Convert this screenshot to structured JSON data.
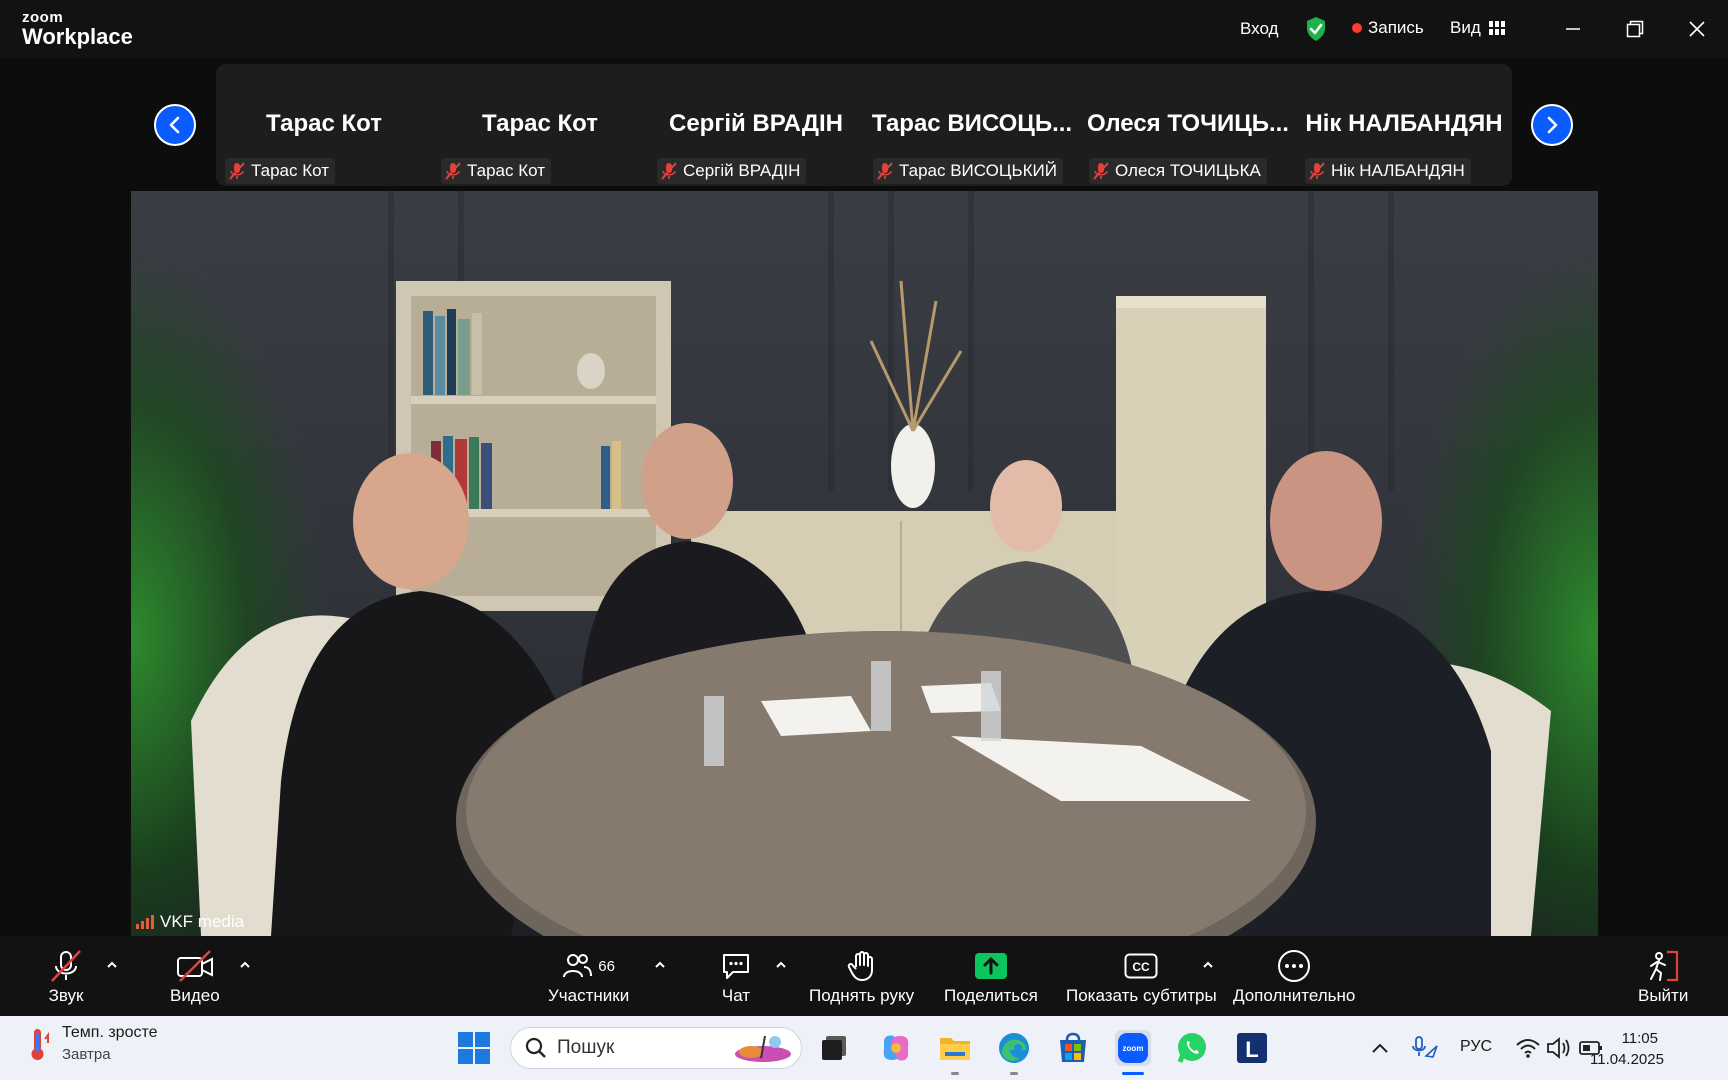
{
  "app": {
    "logo_top": "zoom",
    "logo_bottom": "Workplace"
  },
  "titlebar": {
    "login": "Вход",
    "record": "Запись",
    "view": "Вид"
  },
  "participants_strip": [
    {
      "display": "Тарас Кот",
      "name": "Тарас Кот"
    },
    {
      "display": "Тарас Кот",
      "name": "Тарас Кот"
    },
    {
      "display": "Сергій ВРАДІН",
      "name": "Сергій ВРАДІН"
    },
    {
      "display": "Тарас  ВИСОЦЬ...",
      "name": "Тарас ВИСОЦЬКИЙ"
    },
    {
      "display": "Олеся  ТОЧИЦЬ...",
      "name": "Олеся ТОЧИЦЬКА"
    },
    {
      "display": "Нік НАЛБАНДЯН",
      "name": "Нік НАЛБАНДЯН"
    }
  ],
  "video": {
    "speaker": "VKF media"
  },
  "toolbar": {
    "audio": "Звук",
    "video": "Видео",
    "participants": "Участники",
    "participants_count": "66",
    "chat": "Чат",
    "raise_hand": "Поднять руку",
    "share": "Поделиться",
    "captions": "Показать субтитры",
    "more": "Дополнительно",
    "leave": "Выйти"
  },
  "taskbar": {
    "weather_title": "Темп. зросте",
    "weather_sub": "Завтра",
    "search_placeholder": "Пошук",
    "language": "РУС",
    "time": "11:05",
    "date": "11.04.2025"
  },
  "colors": {
    "accent": "#0b5cff",
    "share_green": "#0bc65f",
    "record_red": "#ff3b30",
    "muted_red": "#e0413a"
  }
}
